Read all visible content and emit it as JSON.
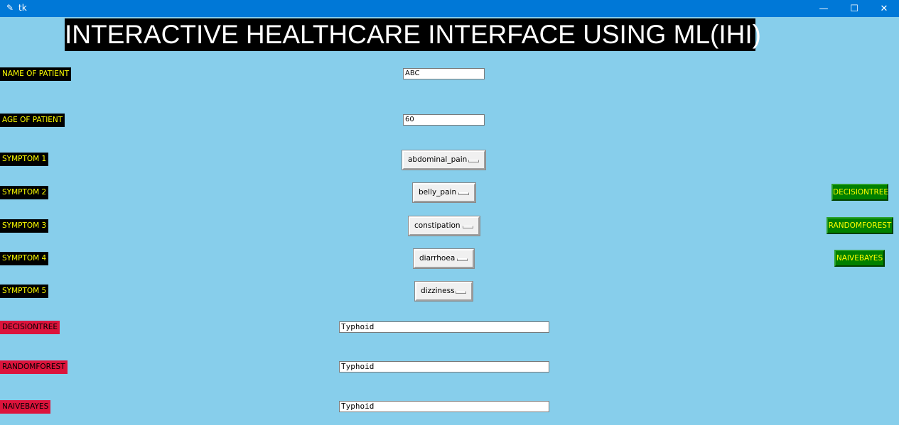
{
  "window": {
    "icon": "feather-icon",
    "title": "tk",
    "controls": {
      "minimize": "—",
      "maximize": "☐",
      "close": "✕"
    }
  },
  "heading": "INTERACTIVE HEALTHCARE INTERFACE USING ML(IHI)",
  "patient": {
    "name_label": "NAME OF PATIENT",
    "name_value": "ABC",
    "age_label": "AGE OF PATIENT",
    "age_value": "60"
  },
  "symptoms": [
    {
      "label": "SYMPTOM 1",
      "value": "abdominal_pain"
    },
    {
      "label": "SYMPTOM 2",
      "value": "belly_pain"
    },
    {
      "label": "SYMPTOM 3",
      "value": "constipation"
    },
    {
      "label": "SYMPTOM 4",
      "value": "diarrhoea"
    },
    {
      "label": "SYMPTOM 5",
      "value": "dizziness"
    }
  ],
  "algorithms": [
    {
      "button": "DECISIONTREE",
      "result_label": "DECISIONTREE",
      "result": "Typhoid"
    },
    {
      "button": "RANDOMFOREST",
      "result_label": "RANDOMFOREST",
      "result": "Typhoid"
    },
    {
      "button": "NAIVEBAYES",
      "result_label": "NAIVEBAYES",
      "result": "Typhoid"
    }
  ],
  "colors": {
    "background": "#87ceeb",
    "titlebar": "#0078d7",
    "label_bg": "#000000",
    "label_text": "#ffff00",
    "result_label_bg": "#dc143c",
    "button_bg": "#008000",
    "button_text": "#ffff00"
  }
}
